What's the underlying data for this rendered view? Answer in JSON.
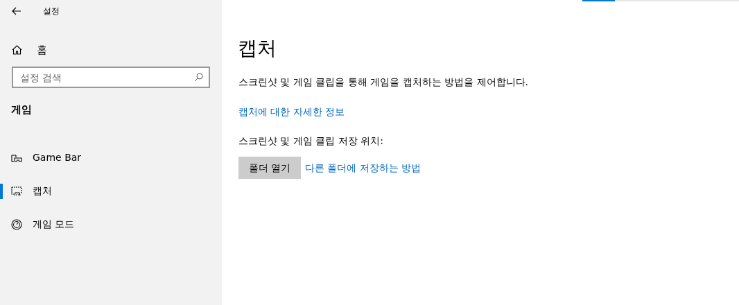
{
  "window": {
    "title": "설정"
  },
  "sidebar": {
    "home": "홈",
    "search": {
      "placeholder": "설정 검색"
    },
    "section": "게임",
    "items": [
      {
        "label": "Game Bar",
        "kind": "gamebar",
        "selected": false
      },
      {
        "label": "캡처",
        "kind": "capture",
        "selected": true
      },
      {
        "label": "게임 모드",
        "kind": "gamemode",
        "selected": false
      }
    ]
  },
  "progress": {
    "level": 0.21
  },
  "content": {
    "title": "캡처",
    "description": "스크린샷 및 게임 클립을 통해 게임을 캡처하는 방법을 제어합니다.",
    "info_link": "캡처에 대한 자세한 정보",
    "location_label": "스크린샷 및 게임 클립 저장 위치:",
    "open_folder_button": "폴더 열기",
    "save_elsewhere_link": "다른 폴더에 저장하는 방법"
  }
}
